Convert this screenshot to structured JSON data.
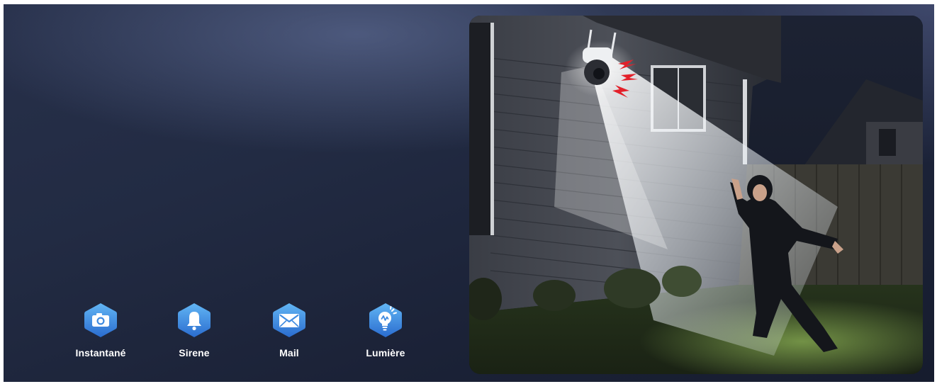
{
  "features": [
    {
      "label": "Instantané",
      "icon": "camera-icon"
    },
    {
      "label": "Sirene",
      "icon": "bell-icon"
    },
    {
      "label": "Mail",
      "icon": "mail-icon"
    },
    {
      "label": "Lumière",
      "icon": "light-bulb-icon"
    }
  ],
  "colors": {
    "icon_blue_top": "#5fb2f2",
    "icon_blue_bottom": "#2c6fd0",
    "alert_red": "#e3202a",
    "background_dark": "#1b2237"
  },
  "photo": {
    "subject": "security-camera-spotlight-scene"
  }
}
